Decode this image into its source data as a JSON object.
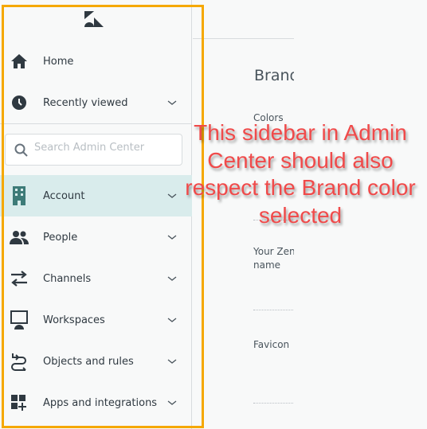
{
  "sidebar": {
    "logo": "Zendesk",
    "home": "Home",
    "recently_viewed": "Recently viewed",
    "search_placeholder": "Search Admin Center",
    "items": [
      {
        "label": "Account",
        "icon": "building-icon",
        "active": true
      },
      {
        "label": "People",
        "icon": "people-icon"
      },
      {
        "label": "Channels",
        "icon": "arrows-icon"
      },
      {
        "label": "Workspaces",
        "icon": "monitor-icon"
      },
      {
        "label": "Objects and rules",
        "icon": "flow-icon"
      },
      {
        "label": "Apps and integrations",
        "icon": "apps-icon"
      }
    ]
  },
  "main": {
    "heading": "Brand",
    "colors_label": "Colors",
    "name_label_1": "Your Zendesk",
    "name_label_2": "name",
    "favicon_label": "Favicon"
  },
  "annotation": {
    "text": "This sidebar in Admin Center should also respect the Brand color selected",
    "color": "#f04a4a",
    "frame_color": "#f5a800"
  },
  "colors": {
    "active_bg": "#d9ecec",
    "active_icon": "#3d7b78",
    "icon": "#2f3941"
  }
}
